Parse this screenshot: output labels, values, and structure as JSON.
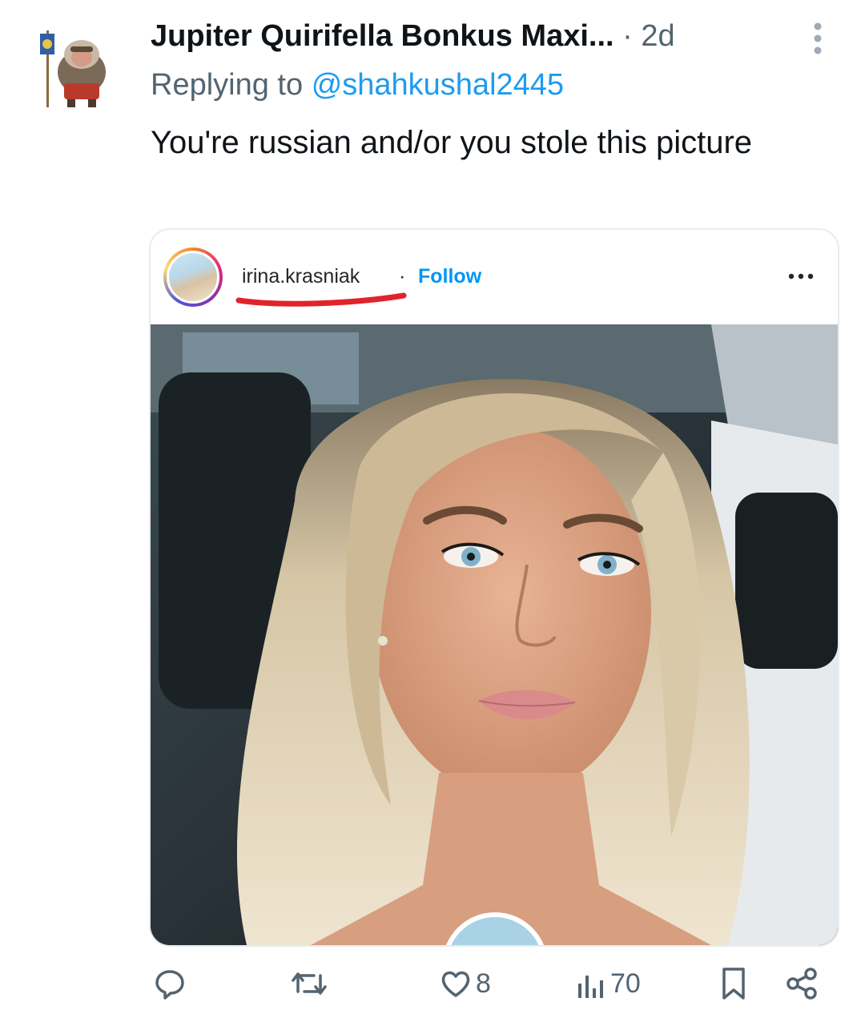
{
  "tweet": {
    "author_name": "Jupiter Quirifella Bonkus Maxi...",
    "separator": "·",
    "time": "2d",
    "replying_prefix": "Replying to",
    "replying_handle": "@shahkushal2445",
    "text": "You're russian and/or you stole this picture"
  },
  "embedded_post": {
    "username": "irina.krasniak",
    "separator": "·",
    "follow_label": "Follow",
    "photo_icon": "selfie-photo"
  },
  "actions": {
    "reply_icon": "reply-icon",
    "retweet_icon": "retweet-icon",
    "like_icon": "heart-icon",
    "like_count": "8",
    "views_icon": "views-icon",
    "views_count": "70",
    "bookmark_icon": "bookmark-icon",
    "share_icon": "share-icon"
  },
  "colors": {
    "text_primary": "#0f1419",
    "text_secondary": "#536471",
    "link": "#1d9bf0",
    "ig_follow": "#0095f6",
    "annotation_red": "#e0242b"
  }
}
